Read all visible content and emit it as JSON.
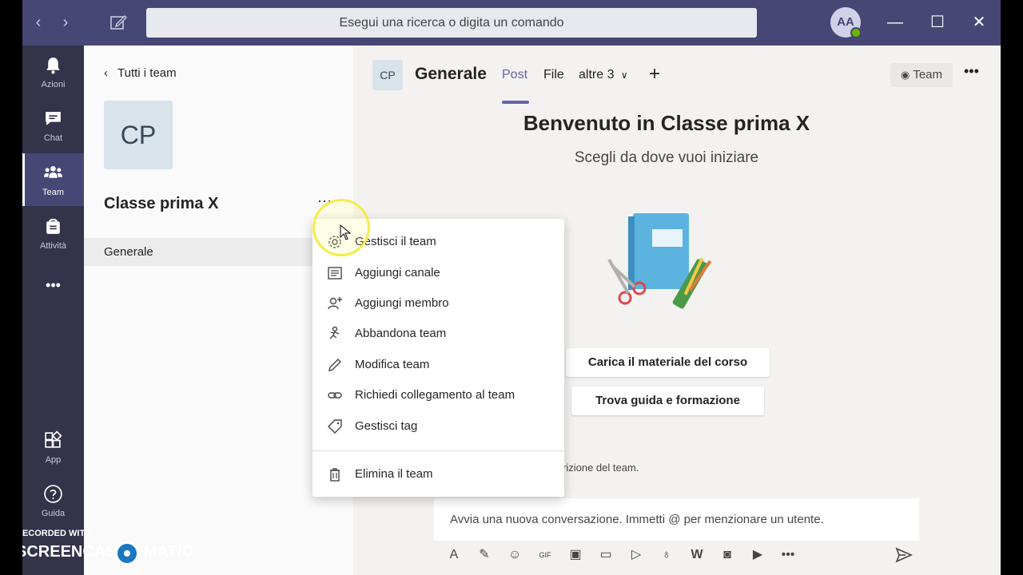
{
  "titlebar": {
    "search_placeholder": "Esegui una ricerca o digita un comando",
    "avatar_initials": "AA",
    "minimize": "—",
    "maximize": "☐",
    "close": "✕"
  },
  "rail": {
    "items": [
      {
        "label": "Azioni",
        "icon": "bell-icon"
      },
      {
        "label": "Chat",
        "icon": "chat-icon"
      },
      {
        "label": "Team",
        "icon": "teams-icon",
        "active": true
      },
      {
        "label": "Attività",
        "icon": "assignments-icon"
      },
      {
        "label": "",
        "icon": "more-icon"
      },
      {
        "label": "App",
        "icon": "apps-icon"
      },
      {
        "label": "Guida",
        "icon": "help-icon"
      }
    ],
    "more_label": "•••"
  },
  "left_panel": {
    "back_label": "Tutti i team",
    "team_initials": "CP",
    "team_name": "Classe prima X",
    "team_more": "···",
    "channel": "Generale"
  },
  "main": {
    "channel_initials": "CP",
    "channel_title": "Generale",
    "tabs": [
      {
        "label": "Post",
        "active": true
      },
      {
        "label": "File"
      },
      {
        "label": "altre 3"
      }
    ],
    "add_tab": "+",
    "team_button": "Team",
    "more": "•••",
    "welcome_title": "Benvenuto in Classe prima X",
    "welcome_subtitle": "Scegli da dove vuoi iniziare",
    "upload_button": "Carica il materiale del corso",
    "guide_button": "Trova guida e formazione",
    "description_partial": "rizione del team.",
    "compose_placeholder": "Avvia una nuova conversazione. Immetti @ per menzionare un utente.",
    "compose_tools": [
      "format-icon",
      "attach-icon",
      "emoji-icon",
      "gif-icon",
      "sticker-icon",
      "meet-icon",
      "stream-icon",
      "praise-icon",
      "wiki-icon",
      "insights-icon",
      "youtube-icon",
      "more-icon"
    ],
    "more_tools": "•••"
  },
  "context_menu": {
    "items": [
      {
        "label": "Gestisci il team",
        "icon": "gear-icon"
      },
      {
        "label": "Aggiungi canale",
        "icon": "channel-add-icon"
      },
      {
        "label": "Aggiungi membro",
        "icon": "add-member-icon"
      },
      {
        "label": "Abbandona team",
        "icon": "leave-icon"
      },
      {
        "label": "Modifica team",
        "icon": "pencil-icon"
      },
      {
        "label": "Richiedi collegamento al team",
        "icon": "link-icon"
      },
      {
        "label": "Gestisci tag",
        "icon": "tag-icon"
      },
      {
        "label": "Elimina il team",
        "icon": "trash-icon"
      }
    ]
  },
  "watermark": {
    "small": "RECORDED WITH",
    "left": "SCREENCAST",
    "right": "MATIC"
  },
  "colors": {
    "titlebar": "#464775",
    "rail": "#33344a",
    "accent": "#6264a7",
    "highlight": "#f3ec4a"
  }
}
